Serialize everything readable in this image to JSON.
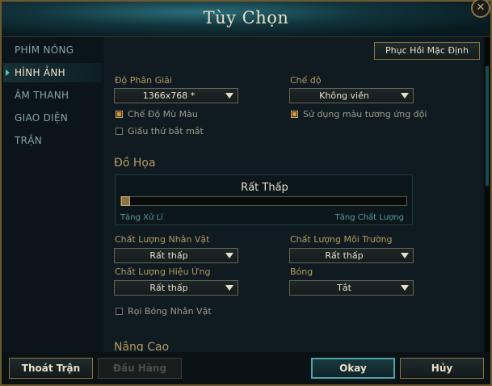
{
  "window": {
    "title": "Tùy Chọn"
  },
  "sidebar": {
    "items": [
      {
        "label": "PHÍM NÓNG",
        "active": false
      },
      {
        "label": "HÌNH ẢNH",
        "active": true
      },
      {
        "label": "ÂM THANH",
        "active": false
      },
      {
        "label": "GIAO DIỆN",
        "active": false
      },
      {
        "label": "TRẬN",
        "active": false
      }
    ]
  },
  "content": {
    "reset_label": "Phục Hồi Mặc Định",
    "resolution": {
      "label": "Độ Phân Giải",
      "value": "1366x768 *"
    },
    "mode": {
      "label": "Chế độ",
      "value": "Không viền"
    },
    "colorblind": {
      "label": "Chế Độ Mù Màu",
      "checked": true
    },
    "hide_eye_candy": {
      "label": "Giấu thứ bắt mắt",
      "checked": false
    },
    "relative_team_colors": {
      "label": "Sử dụng màu tương ứng đội",
      "checked": true
    },
    "graphics": {
      "title": "Đồ Họa",
      "level": "Rất Thấp",
      "slider_value": 0,
      "left_label": "Tăng Xử Lí",
      "right_label": "Tăng Chất Lượng"
    },
    "character_quality": {
      "label": "Chất Lượng Nhân Vật",
      "value": "Rất thấp"
    },
    "environment_quality": {
      "label": "Chất Lượng Môi Trường",
      "value": "Rất thấp"
    },
    "effects_quality": {
      "label": "Chất Lượng Hiệu Ứng",
      "value": "Rất thấp"
    },
    "shadows": {
      "label": "Bóng",
      "value": "Tắt"
    },
    "character_inking": {
      "label": "Rọi Bóng Nhân Vật",
      "checked": false
    },
    "advanced_title": "Nâng Cao"
  },
  "footer": {
    "exit_game": "Thoát Trận",
    "surrender": "Đầu Hàng",
    "okay": "Okay",
    "cancel": "Hủy"
  },
  "colors": {
    "accent_gold": "#c8aa6e",
    "accent_teal": "#4ea3a6",
    "bg": "#0f1b20"
  }
}
